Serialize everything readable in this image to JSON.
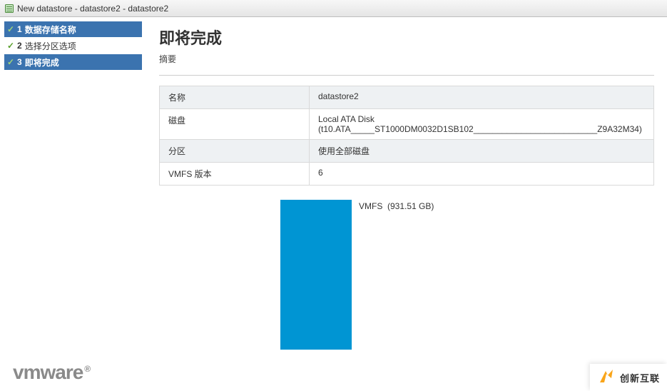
{
  "window": {
    "title": "New datastore - datastore2 - datastore2"
  },
  "wizard": {
    "steps": [
      {
        "num": "1",
        "label": "数据存储名称",
        "done": true,
        "active": false
      },
      {
        "num": "2",
        "label": "选择分区选项",
        "done": true,
        "active": false
      },
      {
        "num": "3",
        "label": "即将完成",
        "done": true,
        "active": true
      }
    ]
  },
  "main": {
    "heading": "即将完成",
    "subheading": "摘要",
    "rows": [
      {
        "key": "名称",
        "value": "datastore2"
      },
      {
        "key": "磁盘",
        "value": "Local ATA Disk (t10.ATA_____ST1000DM0032D1SB102__________________________Z9A32M34)"
      },
      {
        "key": "分区",
        "value": "使用全部磁盘"
      },
      {
        "key": "VMFS 版本",
        "value": "6"
      }
    ],
    "partition": {
      "label": "VMFS",
      "size": "(931.51 GB)",
      "color": "#0095d3"
    }
  },
  "footer": {
    "vendor": "vmware",
    "badge": "创新互联"
  }
}
